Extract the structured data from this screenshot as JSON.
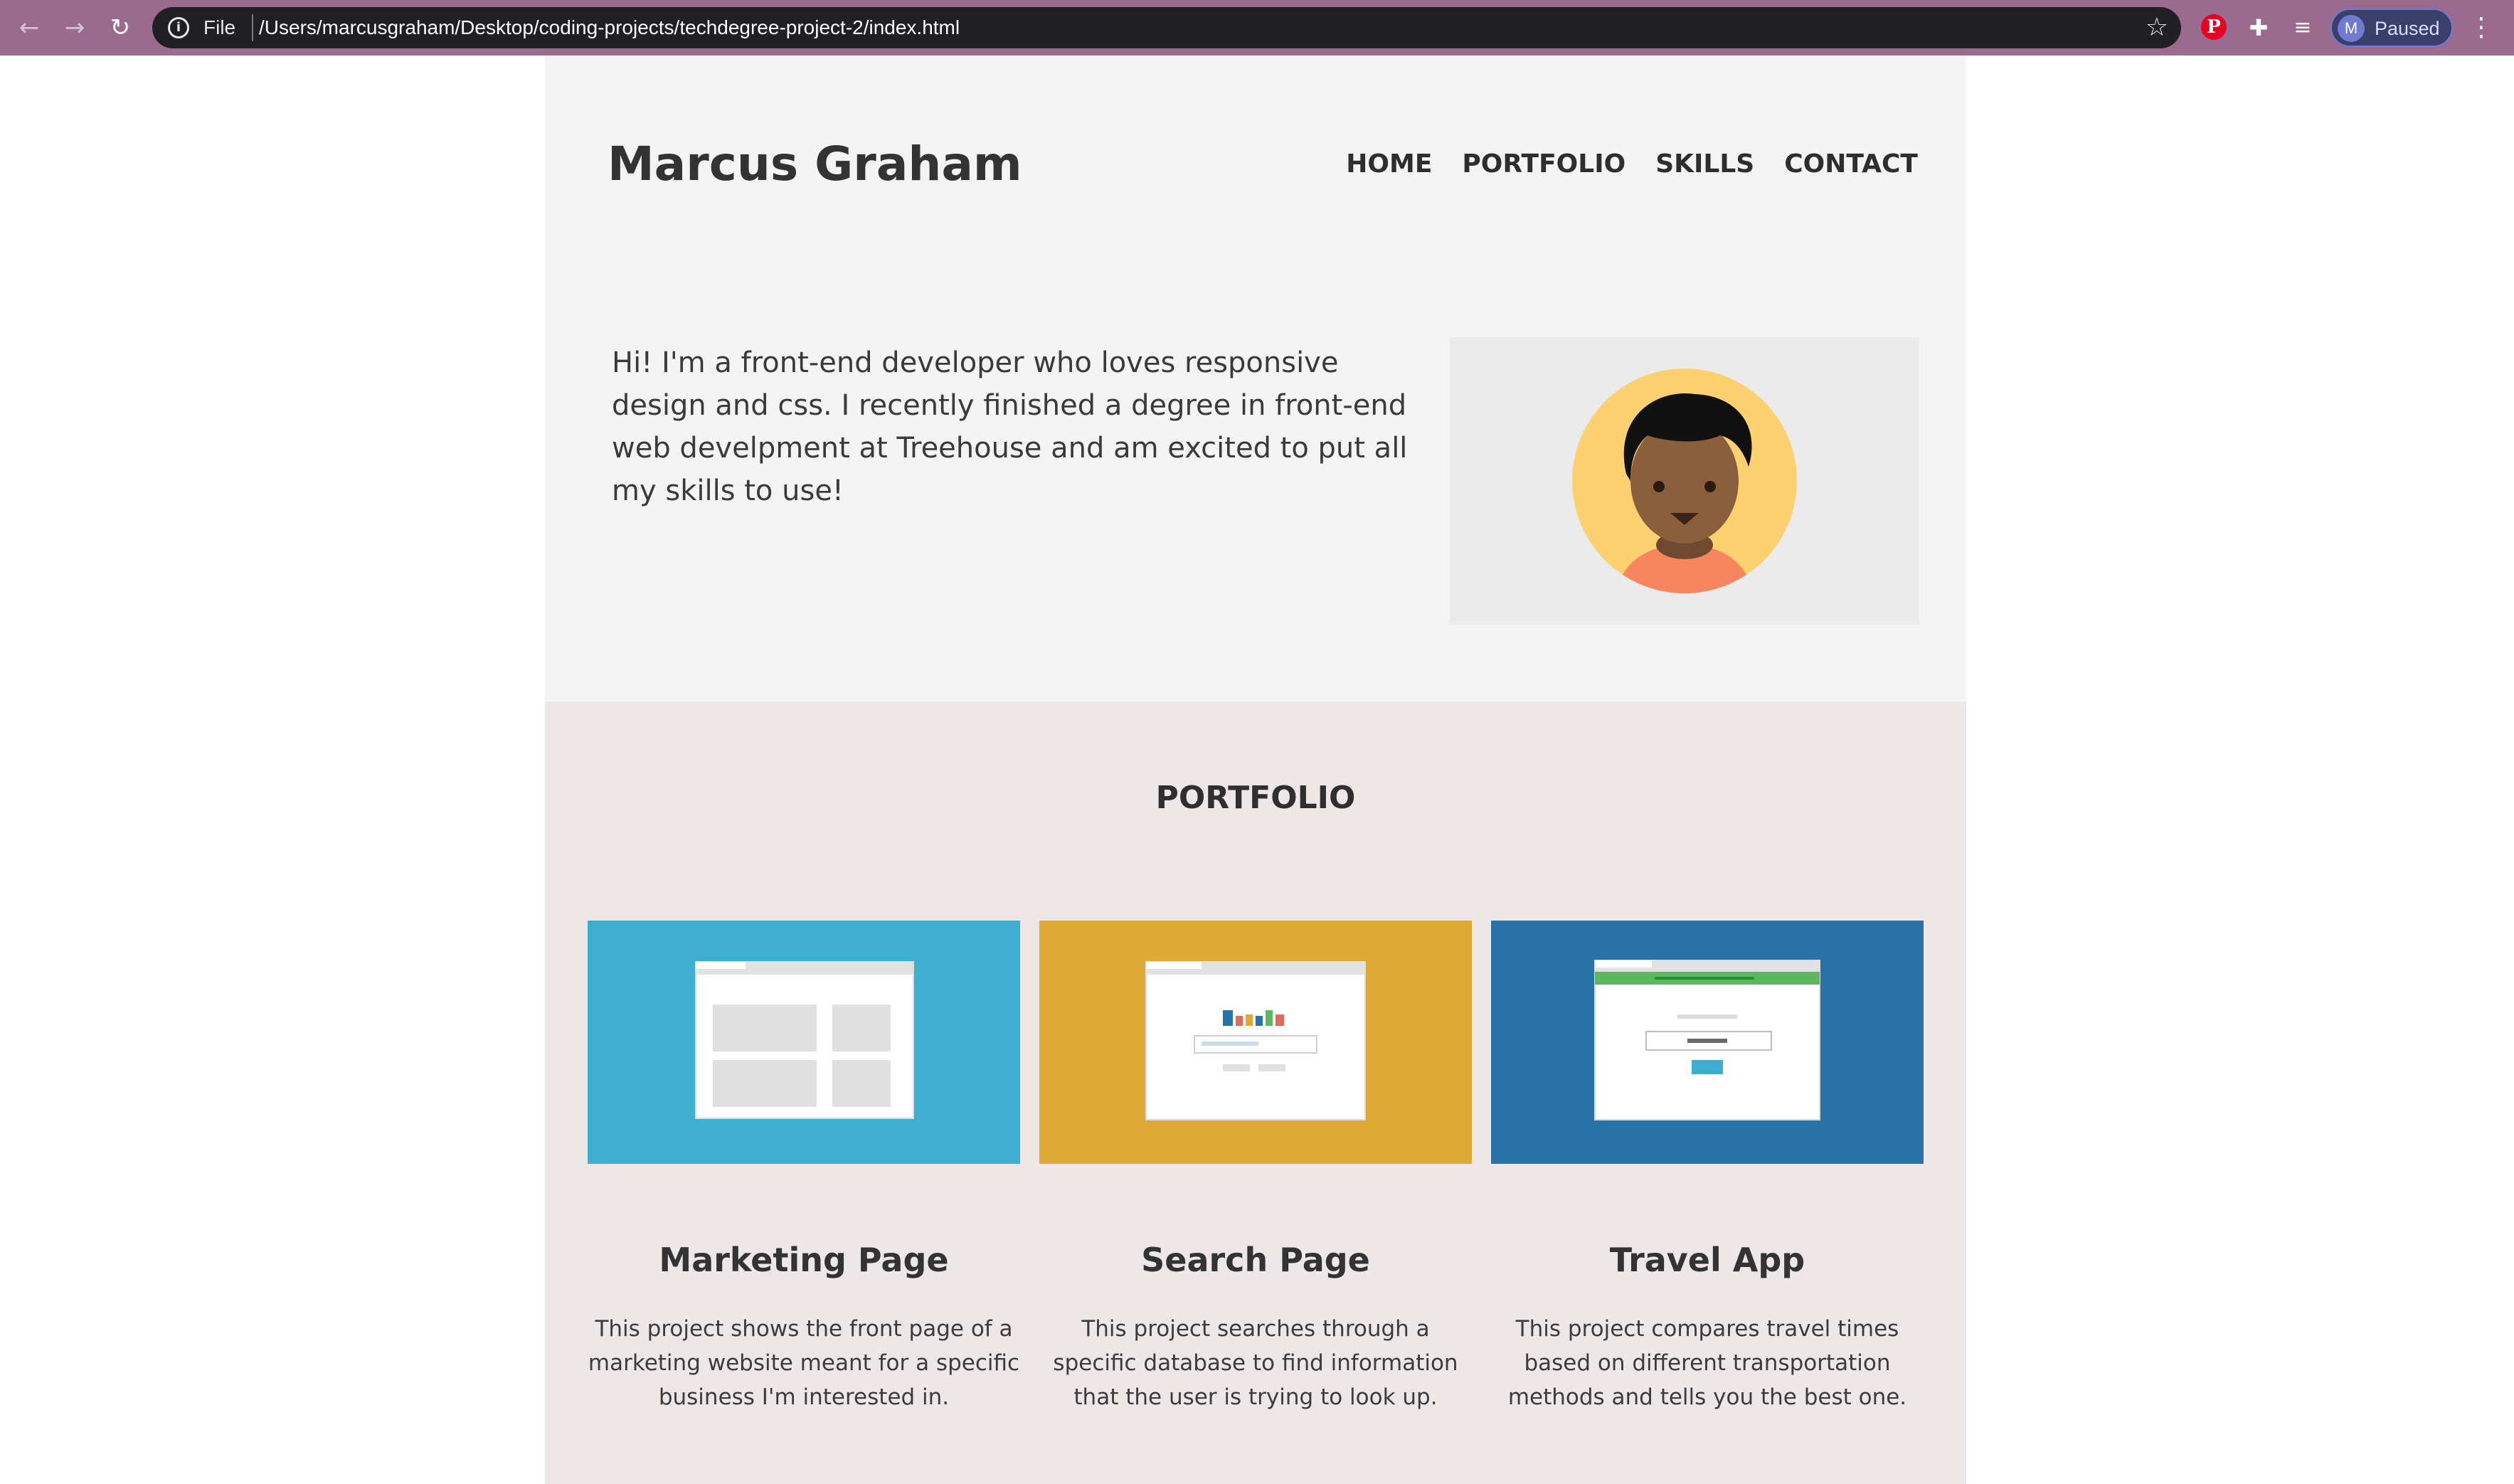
{
  "browser": {
    "scheme_label": "File",
    "url": "/Users/marcusgraham/Desktop/coding-projects/techdegree-project-2/index.html",
    "profile_initial": "M",
    "profile_status": "Paused"
  },
  "site": {
    "title": "Marcus Graham",
    "nav": [
      "HOME",
      "PORTFOLIO",
      "SKILLS",
      "CONTACT"
    ],
    "intro": "Hi! I'm a front-end developer who loves responsive design and css. I recently finished a degree in front-end web develpment at Treehouse and am excited to put all my skills to use!"
  },
  "portfolio": {
    "heading": "PORTFOLIO",
    "projects": [
      {
        "name": "Marketing Page",
        "description": "This project shows the front page of a marketing website meant for a specific business I'm interested in.",
        "color": "#3eaed1"
      },
      {
        "name": "Search Page",
        "description": "This project searches through a specific database to find information that the user is trying to look up.",
        "color": "#dfa935"
      },
      {
        "name": "Travel App",
        "description": "This project compares travel times based on different transportation methods and tells you the best one.",
        "color": "#2a73a9"
      }
    ]
  },
  "colors": {
    "browser_frame": "#9a6a8f",
    "header_bg": "#f4f4f5",
    "portfolio_bg": "#ede7e7"
  }
}
